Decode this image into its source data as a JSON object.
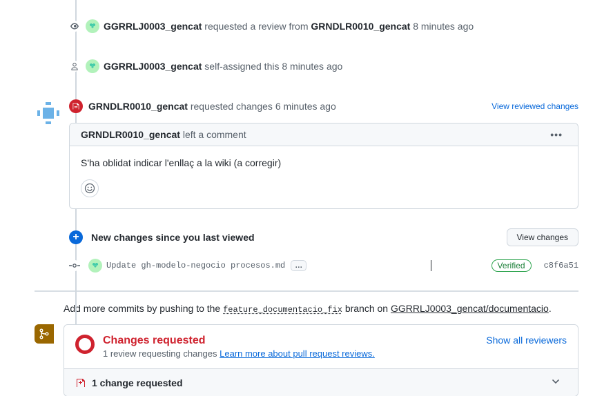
{
  "timeline": {
    "event1": {
      "actor": "GGRRLJ0003_gencat",
      "action": "requested a review from",
      "target": "GRNDLR0010_gencat",
      "time": "8 minutes ago"
    },
    "event2": {
      "actor": "GGRRLJ0003_gencat",
      "action": "self-assigned this",
      "time": "8 minutes ago"
    }
  },
  "review": {
    "actor": "GRNDLR0010_gencat",
    "action": "requested changes",
    "time": "6 minutes ago",
    "view_link": "View reviewed changes",
    "comment_header_suffix": "left a comment",
    "comment_body": "S'ha oblidat indicar l'enllaç a la wiki (a corregir)"
  },
  "new_changes": {
    "label": "New changes since you last viewed",
    "button": "View changes"
  },
  "commit": {
    "message": "Update gh-modelo-negocio procesos.md",
    "verified": "Verified",
    "sha": "c8f6a51"
  },
  "push_hint": {
    "prefix": "Add more commits by pushing to the ",
    "branch": "feature_documentacio_fix",
    "mid": " branch on ",
    "repo": "GGRRLJ0003_gencat/documentacio",
    "suffix": "."
  },
  "status": {
    "title": "Changes requested",
    "sub_prefix": "1 review requesting changes ",
    "learn_more": "Learn more about pull request reviews.",
    "show_all": "Show all reviewers",
    "foot": "1 change requested"
  }
}
